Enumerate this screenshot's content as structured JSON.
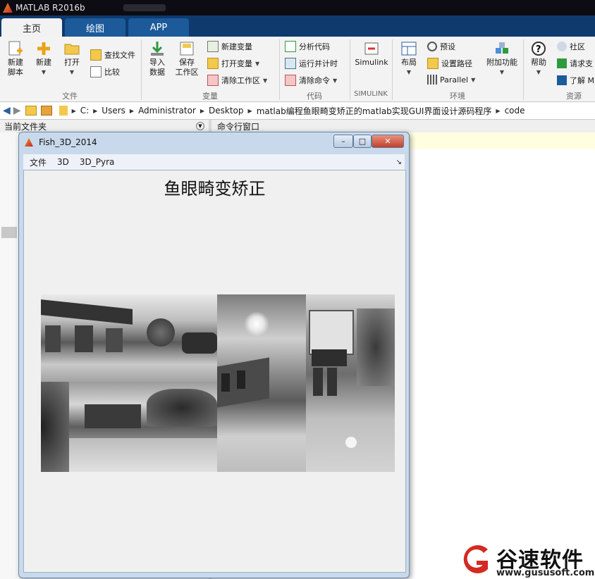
{
  "app": {
    "title": "MATLAB R2016b"
  },
  "tabs": [
    {
      "label": "主页",
      "active": true
    },
    {
      "label": "绘图",
      "active": false
    },
    {
      "label": "APP",
      "active": false
    }
  ],
  "ribbon": {
    "file": {
      "new_script": "新建\n脚本",
      "new": "新建",
      "open": "打开",
      "find_files": "查找文件",
      "compare": "比较",
      "group": "文件"
    },
    "variable": {
      "import": "导入\n数据",
      "save_ws": "保存\n工作区",
      "new_var": "新建变量",
      "open_var": "打开变量",
      "clear_ws": "清除工作区",
      "group": "变量"
    },
    "code": {
      "analyze": "分析代码",
      "run_time": "运行并计时",
      "clear_cmd": "清除命令",
      "group": "代码"
    },
    "simulink": {
      "label": "Simulink",
      "group": "SIMULINK"
    },
    "env": {
      "layout": "布局",
      "prefs": "预设",
      "set_path": "设置路径",
      "parallel": "Parallel",
      "addons": "附加功能",
      "group": "环境"
    },
    "resources": {
      "help": "帮助",
      "community": "社区",
      "request": "请求支",
      "learn": "了解 M",
      "group": "资源"
    }
  },
  "address": {
    "crumbs": [
      "C:",
      "Users",
      "Administrator",
      "Desktop",
      "matlab编程鱼眼畸变矫正的matlab实现GUI界面设计源码程序",
      "code"
    ]
  },
  "panels": {
    "current_folder": "当前文件夹",
    "command_window": "命令行窗口"
  },
  "figure": {
    "title": "Fish_3D_2014",
    "menu": [
      "文件",
      "3D",
      "3D_Pyra"
    ],
    "heading": "鱼眼畸变矫正"
  },
  "watermark": {
    "brand": "谷速软件",
    "url": "www.gususoft.com"
  },
  "colors": {
    "tab_bar": "#0e3a6e",
    "accent": "#1c5a9a",
    "watermark_red": "#d42a22"
  }
}
